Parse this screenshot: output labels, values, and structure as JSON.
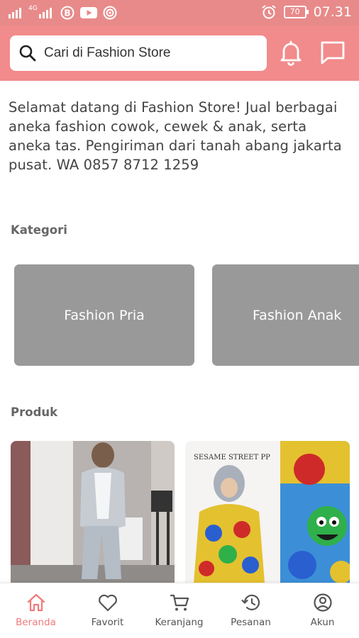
{
  "status_bar": {
    "time": "07.31",
    "battery": "70",
    "network": "4G",
    "status_color": "#e88a8a"
  },
  "header": {
    "search": {
      "placeholder": "Cari di Fashion Store"
    },
    "icons": [
      "search-icon",
      "bell-icon",
      "chat-icon"
    ],
    "brand_color": "#f28b8b"
  },
  "store": {
    "description": "Selamat datang di Fashion Store! Jual berbagai aneka fashion cowok, cewek & anak, serta aneka tas. Pengiriman dari tanah abang jakarta pusat. WA 0857 8712 1259"
  },
  "categories": {
    "title": "Kategori",
    "items": [
      {
        "label": "Fashion Pria"
      },
      {
        "label": "Fashion Anak"
      }
    ]
  },
  "products": {
    "title": "Produk",
    "items": [
      {
        "image_text": ""
      },
      {
        "image_text": "SESAME STREET PP"
      }
    ]
  },
  "bottom_nav": {
    "accent_color": "#f07a7a",
    "items": [
      {
        "label": "Beranda",
        "icon": "home-icon",
        "active": true
      },
      {
        "label": "Favorit",
        "icon": "heart-icon",
        "active": false
      },
      {
        "label": "Keranjang",
        "icon": "cart-icon",
        "active": false
      },
      {
        "label": "Pesanan",
        "icon": "history-icon",
        "active": false
      },
      {
        "label": "Akun",
        "icon": "account-icon",
        "active": false
      }
    ]
  }
}
